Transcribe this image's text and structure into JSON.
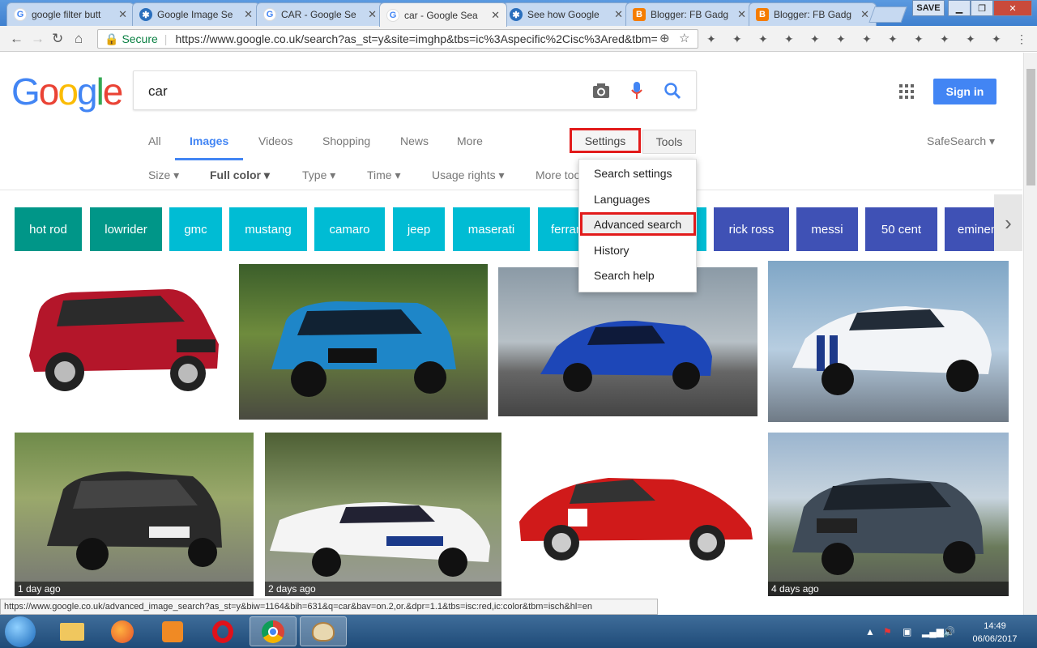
{
  "browser": {
    "tabs": [
      {
        "title": "google filter butt",
        "favicon": "google-favicon"
      },
      {
        "title": "Google Image Se",
        "favicon": "gear-favicon"
      },
      {
        "title": "CAR - Google Se",
        "favicon": "google-favicon"
      },
      {
        "title": "car - Google Sea",
        "favicon": "google-favicon",
        "active": true
      },
      {
        "title": "See how Google",
        "favicon": "gear-favicon"
      },
      {
        "title": "Blogger: FB Gadg",
        "favicon": "blogger-favicon"
      },
      {
        "title": "Blogger: FB Gadg",
        "favicon": "blogger-favicon"
      }
    ],
    "save_label": "SAVE",
    "secure_label": "Secure",
    "url": "https://www.google.co.uk/search?as_st=y&site=imghp&tbs=ic%3Aspecific%2Cisc%3Ared&tbm="
  },
  "google": {
    "logo": "Google",
    "query": "car",
    "sign_in": "Sign in",
    "nav_tabs": [
      "All",
      "Images",
      "Videos",
      "Shopping",
      "News",
      "More"
    ],
    "settings_label": "Settings",
    "tools_label": "Tools",
    "safesearch_label": "SafeSearch",
    "filters": [
      "Size",
      "Full color",
      "Type",
      "Time",
      "Usage rights",
      "More tools"
    ],
    "related": [
      {
        "label": "hot rod",
        "color": "#009688"
      },
      {
        "label": "lowrider",
        "color": "#009688"
      },
      {
        "label": "gmc",
        "color": "#00bcd4"
      },
      {
        "label": "mustang",
        "color": "#00bcd4"
      },
      {
        "label": "camaro",
        "color": "#00bcd4"
      },
      {
        "label": "jeep",
        "color": "#00bcd4"
      },
      {
        "label": "maserati",
        "color": "#00bcd4"
      },
      {
        "label": "ferrari",
        "color": "#00bcd4"
      },
      {
        "label": "rick ross",
        "color": "#3f51b5"
      },
      {
        "label": "messi",
        "color": "#3f51b5"
      },
      {
        "label": "50 cent",
        "color": "#3f51b5"
      },
      {
        "label": "eminem",
        "color": "#3f51b5"
      }
    ],
    "settings_menu": [
      "Search settings",
      "Languages",
      "Advanced search",
      "History",
      "Search help"
    ],
    "image_badges": [
      "1 day ago",
      "2 days ago",
      "4 days ago"
    ]
  },
  "status_url": "https://www.google.co.uk/advanced_image_search?as_st=y&biw=1164&bih=631&q=car&bav=on.2,or.&dpr=1.1&tbs=isc:red,ic:color&tbm=isch&hl=en",
  "taskbar": {
    "time": "14:49",
    "date": "06/06/2017"
  },
  "colors": {
    "accent": "#4285f4",
    "highlight": "#e21b1b"
  }
}
